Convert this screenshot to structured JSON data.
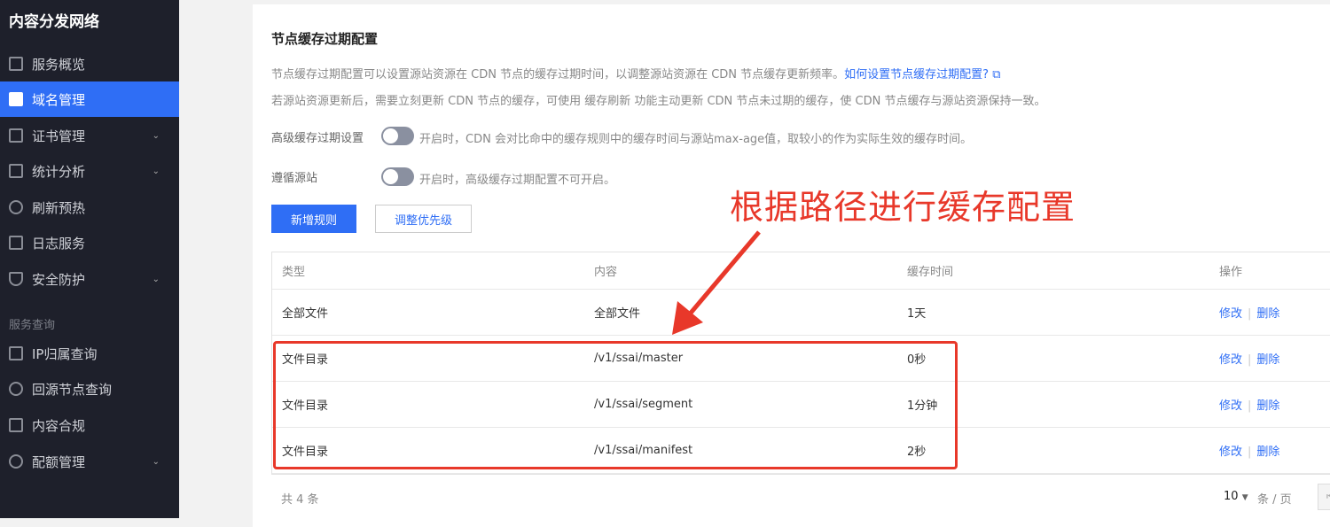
{
  "sidebar": {
    "brand": "内容分发网络",
    "items": [
      {
        "label": "服务概览",
        "icon": "dashboard-icon"
      },
      {
        "label": "域名管理",
        "icon": "domain-icon",
        "active": true
      },
      {
        "label": "证书管理",
        "icon": "certificate-icon",
        "expandable": true
      },
      {
        "label": "统计分析",
        "icon": "bar-chart-icon",
        "expandable": true
      },
      {
        "label": "刷新预热",
        "icon": "refresh-icon"
      },
      {
        "label": "日志服务",
        "icon": "folder-icon"
      },
      {
        "label": "安全防护",
        "icon": "shield-icon",
        "expandable": true
      }
    ],
    "group_label": "服务查询",
    "query_items": [
      {
        "label": "IP归属查询",
        "icon": "ip-icon"
      },
      {
        "label": "回源节点查询",
        "icon": "search-icon"
      },
      {
        "label": "内容合规",
        "icon": "image-icon"
      },
      {
        "label": "配额管理",
        "icon": "pie-icon",
        "expandable": true
      }
    ]
  },
  "main": {
    "title": "节点缓存过期配置",
    "desc1": "节点缓存过期配置可以设置源站资源在 CDN 节点的缓存过期时间，以调整源站资源在 CDN 节点缓存更新频率。",
    "desc1_link": "如何设置节点缓存过期配置?",
    "desc2": "若源站资源更新后，需要立刻更新 CDN 节点的缓存，可使用 缓存刷新 功能主动更新 CDN 节点未过期的缓存，使 CDN 节点缓存与源站资源保持一致。",
    "settings": [
      {
        "label": "高级缓存过期设置",
        "enabled": false,
        "desc": "开启时，CDN 会对比命中的缓存规则中的缓存时间与源站max-age值，取较小的作为实际生效的缓存时间。"
      },
      {
        "label": "遵循源站",
        "enabled": false,
        "desc": "开启时，高级缓存过期配置不可开启。"
      }
    ],
    "add_rule": "新增规则",
    "adjust_priority": "调整优先级",
    "table": {
      "headers": [
        "类型",
        "内容",
        "缓存时间",
        "操作"
      ],
      "rows": [
        {
          "type": "全部文件",
          "content": "全部文件",
          "ttl": "1天"
        },
        {
          "type": "文件目录",
          "content": "/v1/ssai/master",
          "ttl": "0秒"
        },
        {
          "type": "文件目录",
          "content": "/v1/ssai/segment",
          "ttl": "1分钟"
        },
        {
          "type": "文件目录",
          "content": "/v1/ssai/manifest",
          "ttl": "2秒"
        }
      ],
      "edit": "修改",
      "delete": "删除"
    },
    "footer": {
      "total": "共 4 条",
      "page_size": "10",
      "per_page": "条 / 页"
    }
  },
  "annotation": {
    "text": "根据路径进行缓存配置",
    "color": "#e8382a"
  }
}
